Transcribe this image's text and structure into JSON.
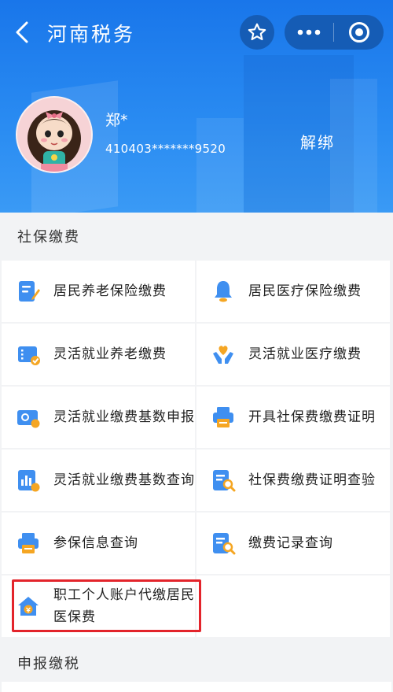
{
  "header": {
    "title": "河南税务",
    "user_name": "郑*",
    "user_id": "410403*******9520",
    "unbind_label": "解绑"
  },
  "sections": {
    "social": "社保缴费",
    "tax": "申报缴税"
  },
  "items": [
    {
      "label": "居民养老保险缴费",
      "icon": "pension-doc-icon"
    },
    {
      "label": "居民医疗保险缴费",
      "icon": "bell-icon"
    },
    {
      "label": "灵活就业养老缴费",
      "icon": "ticket-icon"
    },
    {
      "label": "灵活就业医疗缴费",
      "icon": "heart-hands-icon"
    },
    {
      "label": "灵活就业缴费基数申报",
      "icon": "card-icon"
    },
    {
      "label": "开具社保费缴费证明",
      "icon": "printer-icon"
    },
    {
      "label": "灵活就业缴费基数查询",
      "icon": "chart-icon"
    },
    {
      "label": "社保费缴费证明查验",
      "icon": "doc-search-icon"
    },
    {
      "label": "参保信息查询",
      "icon": "printer-icon"
    },
    {
      "label": "缴费记录查询",
      "icon": "doc-search-icon"
    },
    {
      "label": "职工个人账户代缴居民医保费",
      "icon": "house-icon"
    }
  ],
  "colors": {
    "header_blue": "#1976ea",
    "icon_blue": "#3f8ff0",
    "icon_orange": "#f5a623",
    "highlight_red": "#e3242b"
  }
}
